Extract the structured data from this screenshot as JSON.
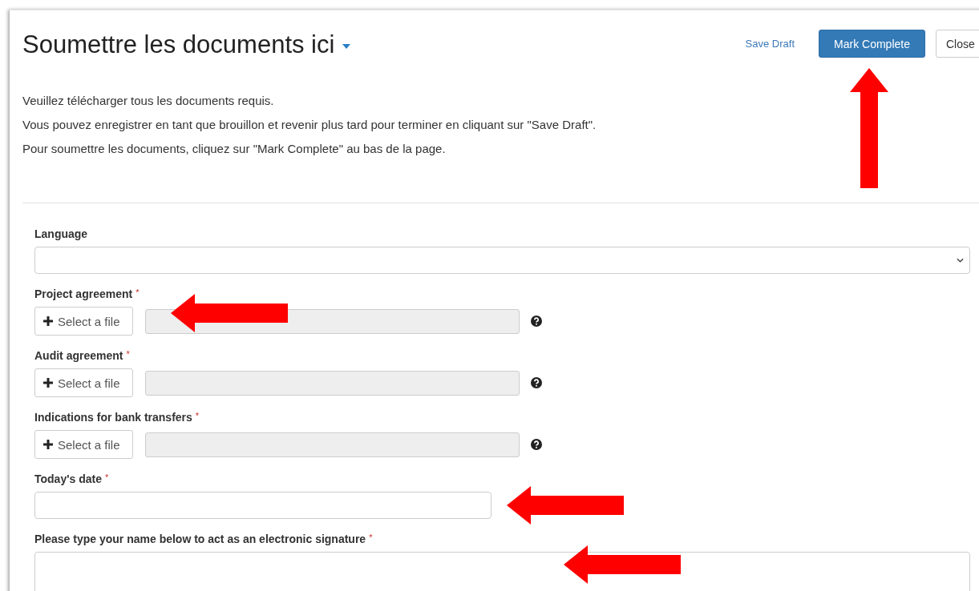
{
  "header": {
    "title": "Soumettre les documents ici",
    "title_has_dropdown": true,
    "buttons": [
      {
        "label": "Save Draft",
        "kind": "link"
      },
      {
        "label": "Mark Complete",
        "kind": "primary"
      },
      {
        "label": "Close",
        "kind": "default"
      }
    ]
  },
  "description": [
    "Veuillez télécharger tous les documents requis.",
    "Vous pouvez enregistrer en tant que brouillon et revenir plus tard pour terminer en cliquant sur \"Save Draft\".",
    "Pour soumettre les documents, cliquez sur \"Mark Complete\" au bas de la page."
  ],
  "fields": [
    {
      "label": "Language",
      "kind": "select"
    },
    {
      "label": "Project agreement",
      "required_mark": "*",
      "kind": "file",
      "button": "Select a file",
      "help_icon": true
    },
    {
      "label": "Audit agreement",
      "required_mark": "*",
      "kind": "file",
      "button": "Select a file",
      "help_icon": true
    },
    {
      "label": "Indications for bank transfers",
      "required_mark": "*",
      "kind": "file",
      "button": "Select a file",
      "help_icon": true
    },
    {
      "label": "Today's date",
      "required_mark": "*",
      "kind": "text"
    },
    {
      "label": "Please type your name below to act as an electronic signature",
      "required_mark": "*",
      "kind": "textarea"
    }
  ],
  "annotation_arrows": [
    {
      "kind": "up"
    },
    {
      "kind": "left"
    },
    {
      "kind": "left"
    },
    {
      "kind": "left"
    }
  ]
}
